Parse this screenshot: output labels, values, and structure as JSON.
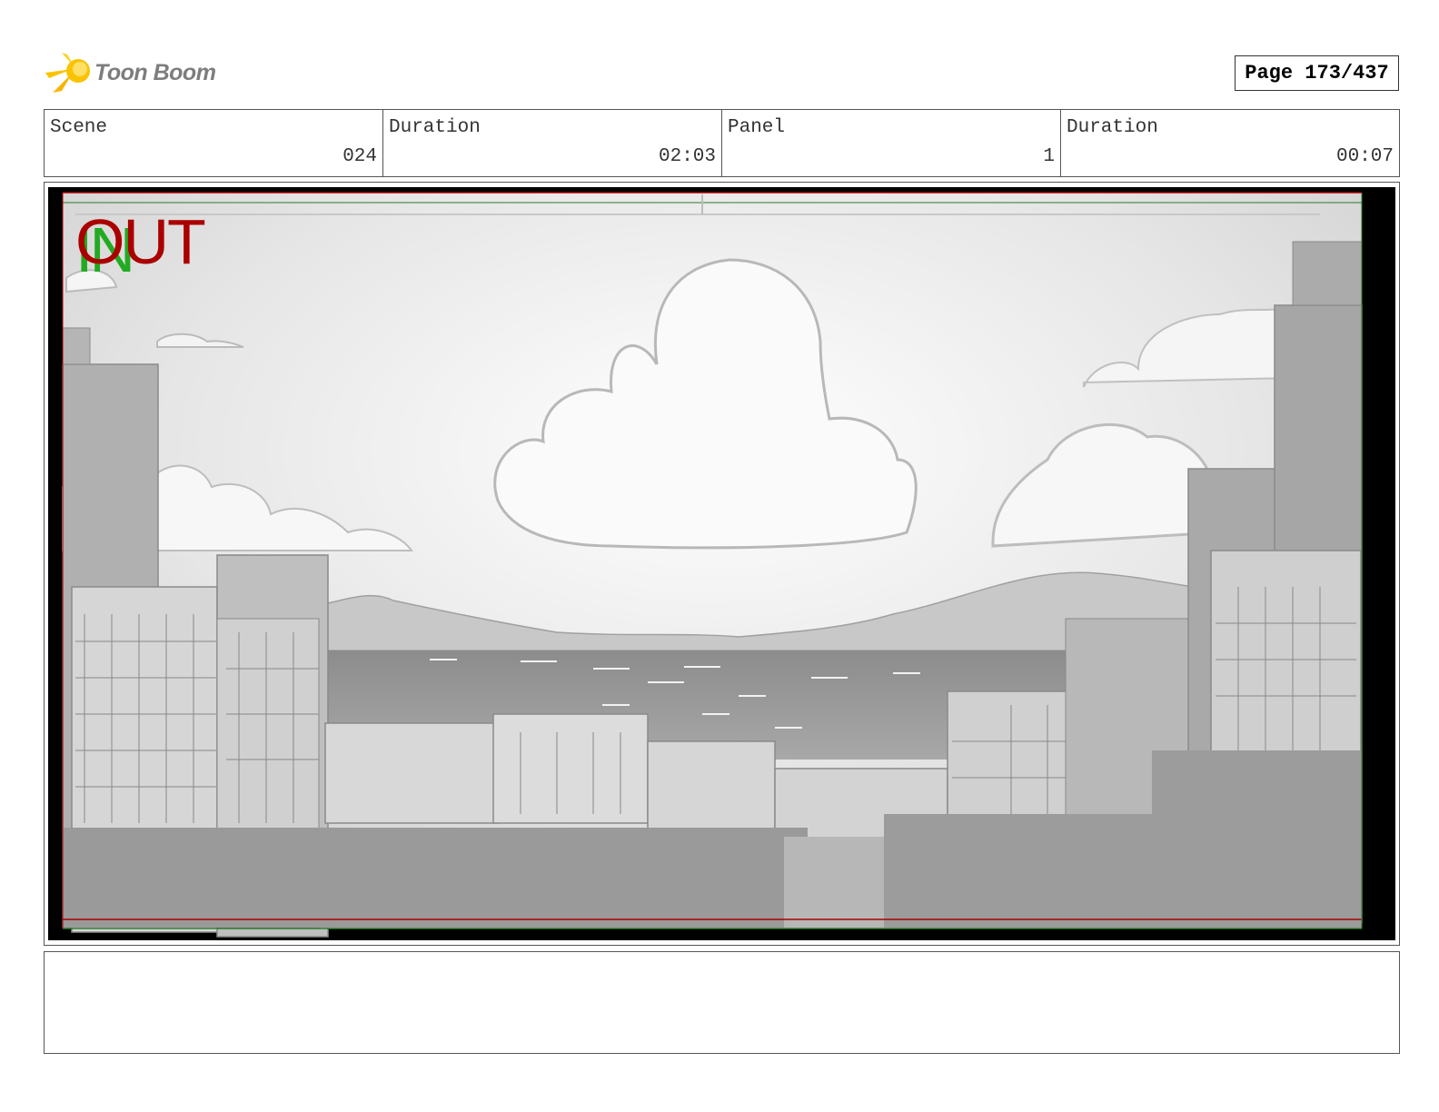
{
  "header": {
    "logo_text": "Toon Boom",
    "page_label": "Page 173/437"
  },
  "info": {
    "scene_label": "Scene",
    "scene_value": "024",
    "scene_duration_label": "Duration",
    "scene_duration_value": "02:03",
    "panel_label": "Panel",
    "panel_value": "1",
    "panel_duration_label": "Duration",
    "panel_duration_value": "00:07"
  },
  "panel": {
    "in_marker": "IN",
    "out_marker": "OUT",
    "in_color": "#22aa22",
    "out_color": "#aa0000"
  },
  "notes": {
    "text": ""
  }
}
